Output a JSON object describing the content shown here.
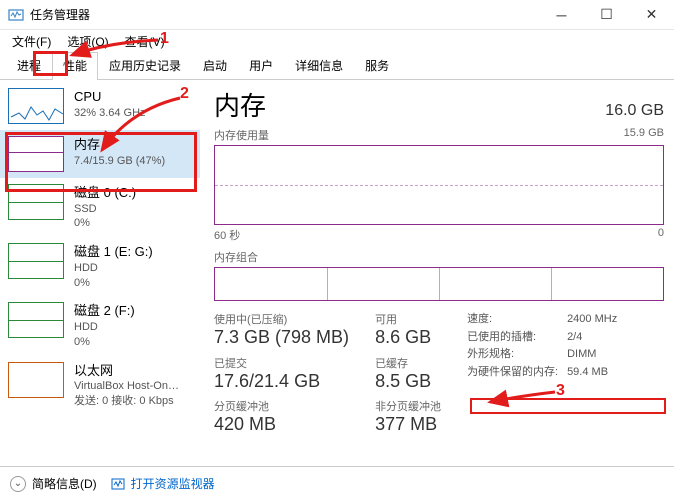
{
  "window": {
    "title": "任务管理器"
  },
  "menu": {
    "file": "文件(F)",
    "options": "选项(O)",
    "view": "查看(V)"
  },
  "tabs": {
    "processes": "进程",
    "performance": "性能",
    "history": "应用历史记录",
    "startup": "启动",
    "users": "用户",
    "details": "详细信息",
    "services": "服务"
  },
  "sidebar": [
    {
      "name": "CPU",
      "sub": "32% 3.64 GHz",
      "thumb": "cpu"
    },
    {
      "name": "内存",
      "sub": "7.4/15.9 GB (47%)",
      "thumb": "mem",
      "selected": true
    },
    {
      "name": "磁盘 0 (C:)",
      "sub1": "SSD",
      "sub2": "0%",
      "thumb": "disk"
    },
    {
      "name": "磁盘 1 (E: G:)",
      "sub1": "HDD",
      "sub2": "0%",
      "thumb": "disk"
    },
    {
      "name": "磁盘 2 (F:)",
      "sub1": "HDD",
      "sub2": "0%",
      "thumb": "disk"
    },
    {
      "name": "以太网",
      "sub1": "VirtualBox Host-On…",
      "sub2": "发送: 0 接收: 0 Kbps",
      "thumb": "eth"
    }
  ],
  "main": {
    "title": "内存",
    "total": "16.0 GB",
    "usage_label": "内存使用量",
    "usage_max": "15.9 GB",
    "x_left": "60 秒",
    "x_right": "0",
    "combo_label": "内存组合",
    "stats": {
      "in_use_label": "使用中(已压缩)",
      "in_use": "7.3 GB (798 MB)",
      "avail_label": "可用",
      "avail": "8.6 GB",
      "committed_label": "已提交",
      "committed": "17.6/21.4 GB",
      "cached_label": "已缓存",
      "cached": "8.5 GB",
      "paged_label": "分页缓冲池",
      "paged": "420 MB",
      "nonpaged_label": "非分页缓冲池",
      "nonpaged": "377 MB"
    },
    "specs": {
      "speed_k": "速度:",
      "speed_v": "2400 MHz",
      "slots_k": "已使用的插槽:",
      "slots_v": "2/4",
      "form_k": "外形规格:",
      "form_v": "DIMM",
      "hw_k": "为硬件保留的内存:",
      "hw_v": "59.4 MB"
    }
  },
  "footer": {
    "brief": "简略信息(D)",
    "open_rm": "打开资源监视器"
  },
  "chart_data": {
    "type": "line",
    "title": "内存使用量",
    "xlabel": "60 秒 → 0",
    "ylabel": "GB",
    "ylim": [
      0,
      15.9
    ],
    "x": [
      60,
      50,
      40,
      30,
      20,
      10,
      0
    ],
    "values": [
      7.4,
      7.4,
      7.4,
      7.4,
      7.4,
      7.4,
      7.4
    ]
  }
}
